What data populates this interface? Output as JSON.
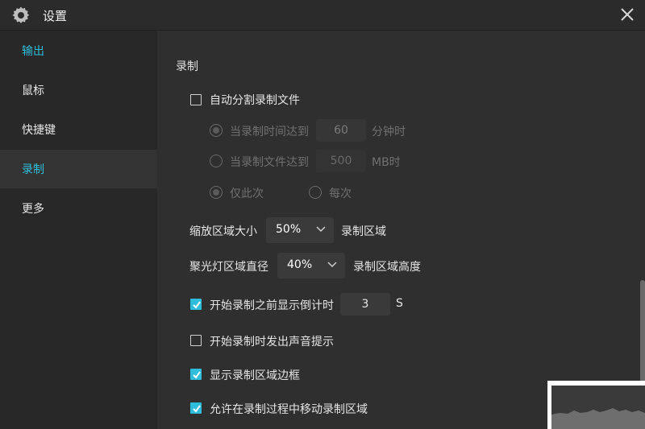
{
  "window": {
    "title": "设置",
    "gear_icon": "gear-icon",
    "close_icon": "close-icon"
  },
  "sidebar": {
    "items": [
      {
        "label": "输出",
        "state": "active"
      },
      {
        "label": "鼠标",
        "state": "normal"
      },
      {
        "label": "快捷键",
        "state": "normal"
      },
      {
        "label": "录制",
        "state": "selected"
      },
      {
        "label": "更多",
        "state": "normal"
      }
    ],
    "accent_color": "#2ebedb"
  },
  "recording": {
    "section_title": "录制",
    "auto_split": {
      "label": "自动分割录制文件",
      "checked": false
    },
    "split_by_time": {
      "label": "当录制时间达到",
      "value": "60",
      "unit": "分钟时",
      "selected": true
    },
    "split_by_size": {
      "label": "当录制文件达到",
      "value": "500",
      "unit": "MB时",
      "selected": false
    },
    "only_this_time": {
      "label": "仅此次",
      "selected": true
    },
    "every_time": {
      "label": "每次",
      "selected": false
    },
    "zoom_area": {
      "label": "缩放区域大小",
      "value": "50%",
      "suffix": "录制区域"
    },
    "spotlight": {
      "label": "聚光灯区域直径",
      "value": "40%",
      "suffix": "录制区域高度"
    },
    "countdown": {
      "label": "开始录制之前显示倒计时",
      "checked": true,
      "value": "3",
      "unit": "S"
    },
    "sound_hint": {
      "label": "开始录制时发出声音提示",
      "checked": false
    },
    "show_border": {
      "label": "显示录制区域边框",
      "checked": true
    },
    "allow_move": {
      "label": "允许在录制过程中移动录制区域",
      "checked": true
    }
  }
}
